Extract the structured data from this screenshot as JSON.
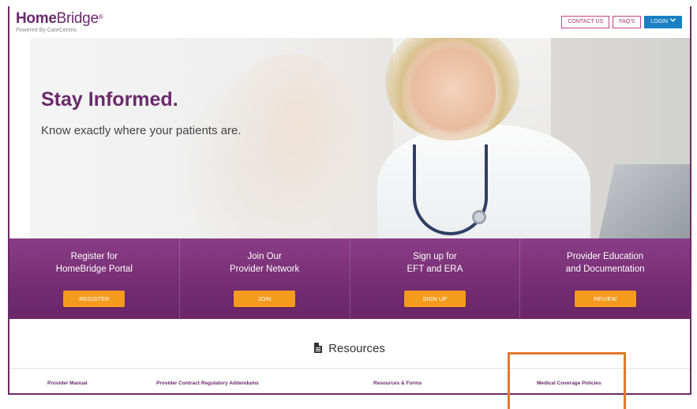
{
  "logo": {
    "brand_bold": "Home",
    "brand_light": "Bridge",
    "reg_mark": "®",
    "tagline": "Powered By CareCentrix"
  },
  "top_nav": {
    "contact_label": "CONTACT US",
    "faqs_label": "FAQ'S",
    "login_label": "LOGIN",
    "login_icon": "chevron-down-icon"
  },
  "hero": {
    "title": "Stay Informed.",
    "subtitle": "Know exactly where your patients are."
  },
  "actions": [
    {
      "line1": "Register for",
      "line2": "HomeBridge Portal",
      "button": "REGISTER"
    },
    {
      "line1": "Join Our",
      "line2": "Provider Network",
      "button": "JOIN"
    },
    {
      "line1": "Sign up for",
      "line2": "EFT and ERA",
      "button": "SIGN UP"
    },
    {
      "line1": "Provider Education",
      "line2": "and Documentation",
      "button": "REVIEW"
    }
  ],
  "resources": {
    "heading": "Resources",
    "icon": "document-icon",
    "links": [
      "Provider Manual",
      "Provider Contract Regulatory Addendums",
      "Resources & Forms",
      "Medical Coverage Policies"
    ]
  },
  "colors": {
    "brand_purple": "#6b2a6b",
    "button_orange": "#f49a1d",
    "login_blue": "#1a7fc3",
    "highlight_orange": "#e2782e"
  }
}
